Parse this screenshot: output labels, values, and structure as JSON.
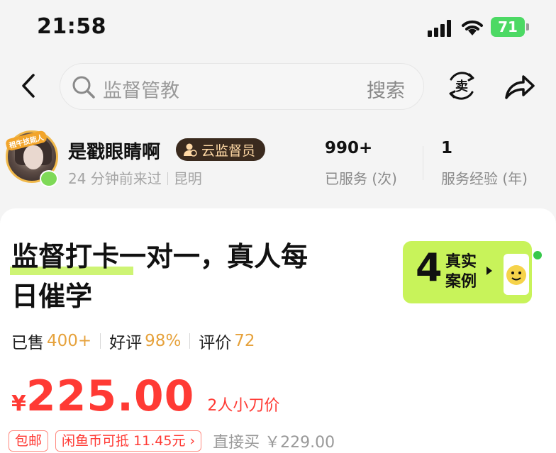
{
  "status_bar": {
    "time": "21:58",
    "battery": "71"
  },
  "nav": {
    "search_placeholder": "监督管教",
    "search_button": "搜索",
    "sell_icon_label": "卖"
  },
  "seller": {
    "avatar_tag": "租牛技能人",
    "name": "是戳眼睛啊",
    "badge": "云监督员",
    "last_seen": "24 分钟前来过",
    "location": "昆明",
    "stats": [
      {
        "value": "990+",
        "label": "已服务 (次)"
      },
      {
        "value": "1",
        "label": "服务经验 (年)"
      }
    ]
  },
  "product": {
    "title_line1": "监督打卡一对一，真人每",
    "title_line2": "日催学",
    "cases_count": "4",
    "cases_label": "真实案例",
    "sold_label": "已售",
    "sold_value": "400+",
    "rating_label": "好评",
    "rating_value": "98%",
    "reviews_label": "评价",
    "reviews_value": "72",
    "price_symbol": "¥",
    "price": "225.00",
    "price_note": "2人小刀价",
    "tag_free_shipping": "包邮",
    "tag_coin": "闲鱼币可抵 11.45元 ›",
    "direct_buy": "直接买 ￥229.00"
  },
  "colors": {
    "price": "#ff3a34",
    "accent_green": "#c8f35a",
    "stat_orange": "#e6a23c",
    "badge_bg": "#3a2a1e"
  }
}
